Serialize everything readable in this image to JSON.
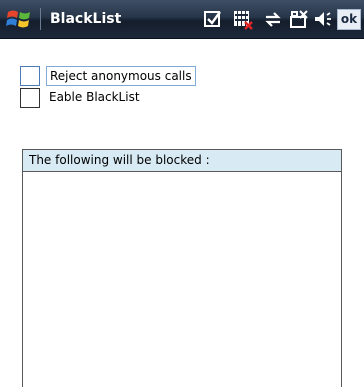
{
  "titlebar": {
    "app_title": "BlackList",
    "ok_label": "ok",
    "icons": [
      "windows-start-icon",
      "checkmark-icon",
      "signal-blocked-icon",
      "sync-arrows-icon",
      "battery-icon",
      "speaker-icon"
    ]
  },
  "options": {
    "reject_anonymous_label": "Reject anonymous calls",
    "reject_anonymous_checked": false,
    "enable_blacklist_label": "Eable BlackList",
    "enable_blacklist_checked": false
  },
  "block_list": {
    "header": "The following will be blocked :",
    "items": []
  },
  "colors": {
    "titlebar_bg": "#1c283a",
    "panel_header_bg": "#d8eaf3",
    "focus_border": "#7fa9d6"
  }
}
